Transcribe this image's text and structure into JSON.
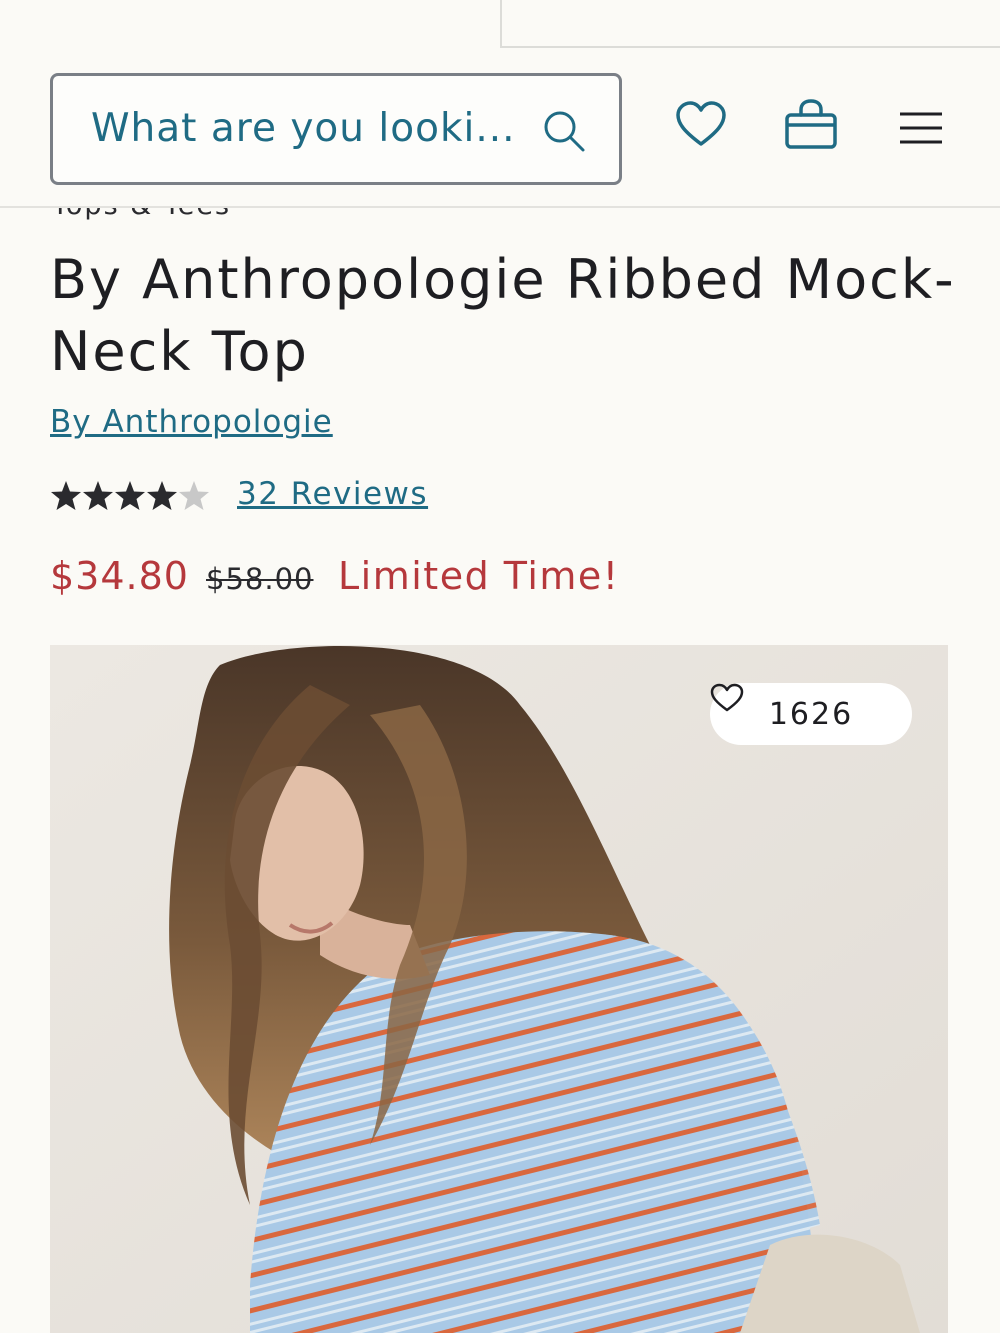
{
  "header": {
    "search_placeholder": "What are you looki...",
    "icons": [
      "search-icon",
      "heart-icon",
      "shopping-bag-icon",
      "menu-icon"
    ]
  },
  "breadcrumb": "Tops & Tees",
  "product": {
    "title": "By Anthropologie Ribbed Mock-Neck Top",
    "brand": "By Anthropologie",
    "rating": 4.5,
    "reviews_label": "32 Reviews",
    "sale_price": "$34.80",
    "original_price": "$58.00",
    "promo_label": "Limited Time!",
    "favorites_count": "1626"
  },
  "colors": {
    "link": "#1f6b84",
    "sale": "#b5383c",
    "background": "#fbfaf6"
  }
}
